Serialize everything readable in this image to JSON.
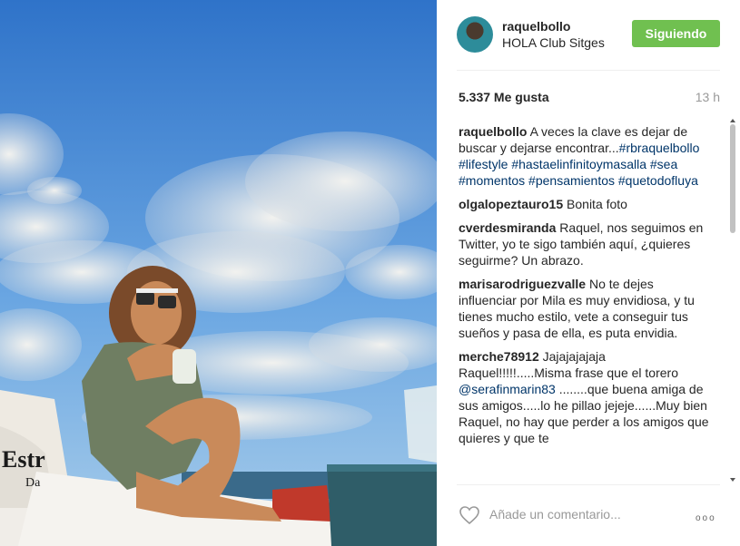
{
  "post": {
    "username": "raquelbollo",
    "location": "HOLA Club Sitges",
    "follow_label": "Siguiendo",
    "likes": "5.337 Me gusta",
    "time": "13 h"
  },
  "caption": {
    "username": "raquelbollo",
    "text": "A veces la clave es dejar de buscar y dejarse encontrar...",
    "hashtags": [
      "#rbraquelbollo",
      "#lifestyle",
      "#hastaelinfinitoymasalla",
      "#sea",
      "#momentos",
      "#pensamientos",
      "#quetodofluya"
    ]
  },
  "comments": [
    {
      "username": "olgalopeztauro15",
      "text": "Bonita foto"
    },
    {
      "username": "cverdesmiranda",
      "text": "Raquel, nos seguimos en Twitter, yo te sigo también aquí, ¿quieres seguirme? Un abrazo."
    },
    {
      "username": "marisarodriguezvalle",
      "text": "No te dejes influenciar por Mila es muy envidiosa, y tu tienes mucho estilo, vete a conseguir tus sueños y pasa de ella, es puta envidia."
    },
    {
      "username": "merche78912",
      "text_before": "Jajajajajaja Raquel!!!!!.....Misma frase que el torero",
      "mention": "@serafinmarin83",
      "text_after": "........que buena amiga de sus amigos.....lo he pillao jejeje......Muy bien Raquel, no hay que perder a los amigos que quieres y que te"
    }
  ],
  "footer": {
    "comment_placeholder": "Añade un comentario...",
    "more_label": "ooo"
  },
  "photo": {
    "cushion_logo_text": "Estr",
    "cushion_sub_text": "Da"
  },
  "icons": {
    "heart": "heart-icon",
    "more": "more-options-icon"
  },
  "colors": {
    "follow_button": "#70c050",
    "hashtag": "#003569",
    "sky_top": "#2f73c9"
  }
}
